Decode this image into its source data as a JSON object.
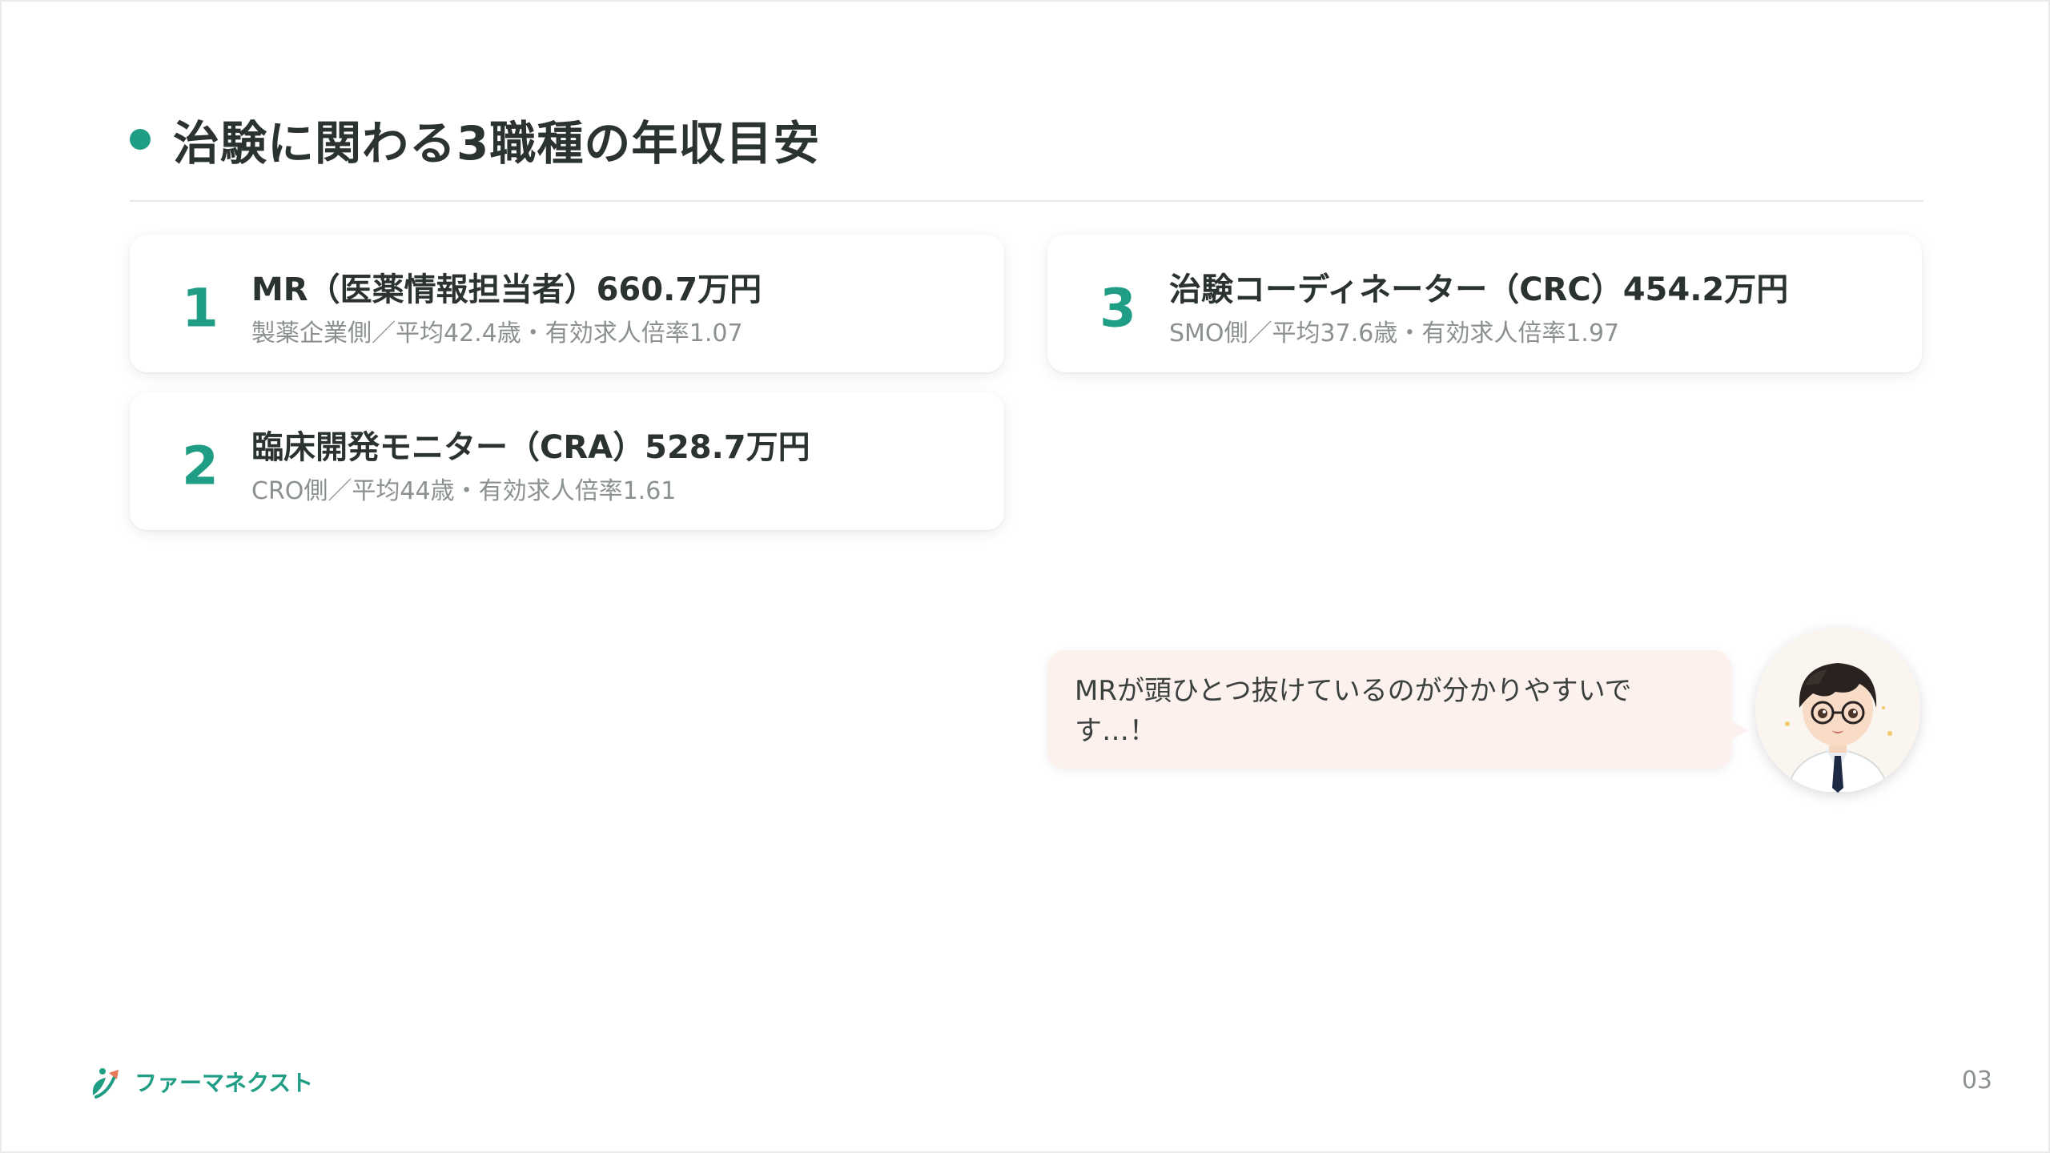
{
  "slide": {
    "title": "治験に関わる3職種の年収目安",
    "page_number": "03"
  },
  "cards": [
    {
      "number": "1",
      "title": "MR（医薬情報担当者）660.7万円",
      "subtitle": "製薬企業側／平均42.4歳・有効求人倍率1.07"
    },
    {
      "number": "2",
      "title": "臨床開発モニター（CRA）528.7万円",
      "subtitle": "CRO側／平均44歳・有効求人倍率1.61"
    },
    {
      "number": "3",
      "title": "治験コーディネーター（CRC）454.2万円",
      "subtitle": "SMO側／平均37.6歳・有効求人倍率1.97"
    }
  ],
  "speech": {
    "text": "MRが頭ひとつ抜けているのが分かりやすいで\nす…！"
  },
  "footer": {
    "logo_text": "ファーマネクスト"
  },
  "colors": {
    "accent": "#1f9e85",
    "bubble_bg": "#fdf1ee",
    "text_main": "#2b332f",
    "text_sub": "#8b918e"
  },
  "icons": {
    "heading_marker": "dot-icon",
    "avatar": "doctor-avatar-icon",
    "logo": "leaf-arrow-logo-icon"
  }
}
